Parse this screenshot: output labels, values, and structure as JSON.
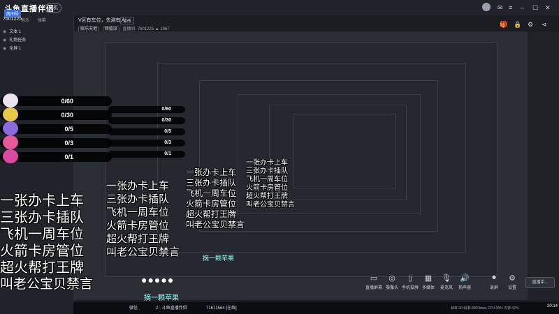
{
  "app": {
    "logo_text": "斗鱼直播伴侣",
    "status_chip": "待机",
    "badge": "房间号",
    "uid": "7601225",
    "side_tabs": [
      "音乐",
      "弹幕"
    ],
    "layers": [
      {
        "label": "文本 1"
      },
      {
        "label": "礼物任务"
      },
      {
        "label": "全屏 1"
      }
    ]
  },
  "header": {
    "title": "V区有车位，先测有人",
    "edit_label": "修改",
    "sub_pills": [
      "娱乐天地",
      "颜值派"
    ],
    "room_label": "直播间: 7601225",
    "viewers": "1967"
  },
  "overlay": {
    "counters": [
      "0/60",
      "0/30",
      "0/5",
      "0/3",
      "0/1"
    ],
    "text_lines": [
      "一张办卡上车",
      "三张办卡插队",
      "飞机一周车位",
      "火箭卡房管位",
      "超火帮打王牌",
      "叫老公宝贝禁言"
    ],
    "dots": "●●●●●",
    "apple": "摘一颗苹果"
  },
  "bottom_controls": [
    {
      "icon": "screen-icon",
      "label": "直播屏幕"
    },
    {
      "icon": "camera-icon",
      "label": "摄像头"
    },
    {
      "icon": "phone-icon",
      "label": "手机投屏"
    },
    {
      "icon": "media-icon",
      "label": "多媒体"
    },
    {
      "icon": "mic-icon",
      "label": "麦克风"
    },
    {
      "icon": "volume-icon",
      "label": "扬声器"
    },
    {
      "icon": "record-icon",
      "label": "录屏"
    },
    {
      "icon": "settings-icon",
      "label": "设置"
    }
  ],
  "start_label": "直播中...",
  "taskbar": {
    "items": [
      "微信",
      "2 - 斗鱼直播伴侣",
      "71671564 [在线]"
    ],
    "stats": "帧率:30  码率:2500kbps  CPU:35%  内存:42%",
    "time": "20:14"
  },
  "colors": {
    "accent": "#3a6fd8",
    "bg": "#1b1d23"
  }
}
